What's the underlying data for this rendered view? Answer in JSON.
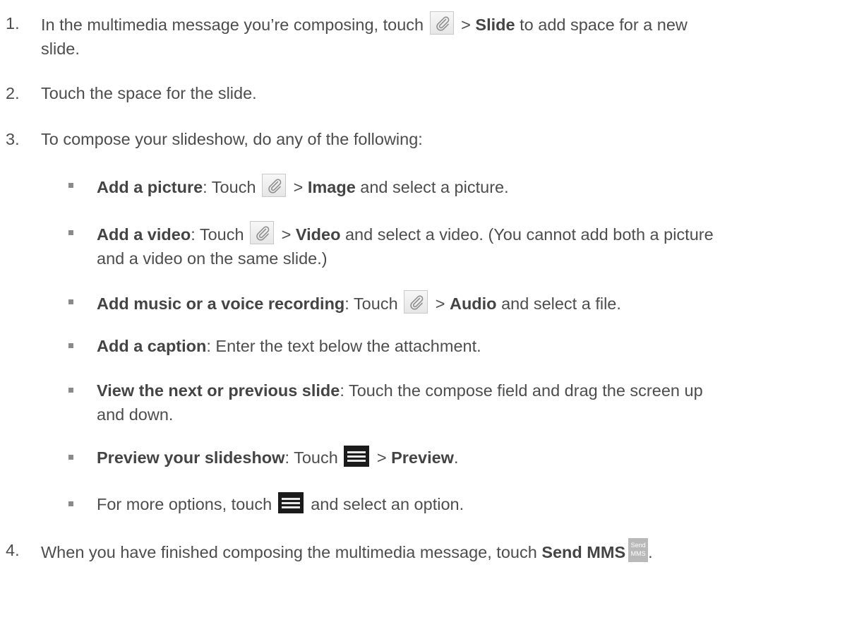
{
  "steps": [
    {
      "number": "1.",
      "before": "In the multimedia message you’re composing, touch ",
      "between": " > ",
      "bold": "Slide",
      "after_line1": " to add space for a new",
      "line2": "slide."
    },
    {
      "number": "2.",
      "text": "Touch the space for the slide."
    },
    {
      "number": "3.",
      "text": "To compose your slideshow, do any of the following:"
    },
    {
      "number": "4.",
      "before": "When you have finished composing the multimedia message, touch ",
      "bold": "Send MMS",
      "after": "."
    }
  ],
  "bullets": {
    "picture": {
      "bold": "Add a picture",
      "colon": ": Touch ",
      "gt": " > ",
      "bold2": "Image",
      "after": " and select a picture."
    },
    "video": {
      "bold": "Add a video",
      "colon": ": Touch ",
      "gt": " > ",
      "bold2": "Video",
      "after_line1": " and select a video. (You cannot add both a picture",
      "line2": "and a video on the same slide.)"
    },
    "audio": {
      "bold": "Add music or a voice recording",
      "colon": ": Touch ",
      "gt": " > ",
      "bold2": "Audio",
      "after": " and select a file."
    },
    "caption": {
      "bold": "Add a caption",
      "after": ": Enter the text below the attachment."
    },
    "view": {
      "bold": "View the next or previous slide",
      "after_line1": ": Touch the compose field and drag the screen up",
      "line2": "and down."
    },
    "preview": {
      "bold": "Preview your slideshow",
      "colon": ": Touch ",
      "gt": " > ",
      "bold2": "Preview",
      "after": "."
    },
    "more": {
      "before": "For more options, touch ",
      "after": " and select an option."
    }
  },
  "icons": {
    "attach": "paperclip-icon",
    "menu": "menu-icon",
    "send_line1": "Send",
    "send_line2": "MMS"
  }
}
